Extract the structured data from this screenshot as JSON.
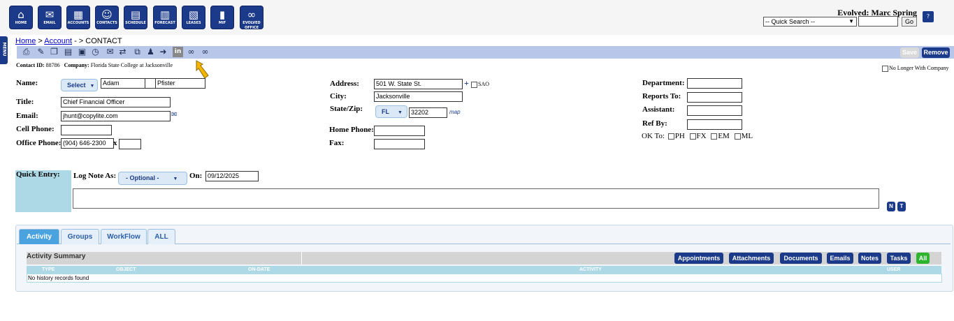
{
  "nav": {
    "items": [
      {
        "label": "HOME",
        "icon": "home-icon"
      },
      {
        "label": "EMAIL",
        "icon": "email-icon"
      },
      {
        "label": "ACCOUNTS",
        "icon": "accounts-icon"
      },
      {
        "label": "CONTACTS",
        "icon": "contacts-icon"
      },
      {
        "label": "SCHEDULE",
        "icon": "schedule-icon"
      },
      {
        "label": "FORECAST",
        "icon": "forecast-icon"
      },
      {
        "label": "LEASES",
        "icon": "leases-icon"
      },
      {
        "label": "MIF",
        "icon": "mif-icon"
      },
      {
        "label": "EVOLVED OFFICE",
        "icon": "evolved-office-icon"
      }
    ]
  },
  "user": {
    "greeting": "Evolved: Marc Spring"
  },
  "quick_search": {
    "selected": "-- Quick Search --",
    "value": "",
    "go_label": "Go"
  },
  "side_menu": {
    "label": "MENU"
  },
  "breadcrumb": {
    "home": "Home",
    "sep1": " > ",
    "account": "Account",
    "sep2": " - > CONTACT"
  },
  "actions": {
    "save": "Save",
    "remove": "Remove"
  },
  "meta": {
    "contact_id_label": "Contact ID:",
    "contact_id": "88786",
    "company_label": "Company:",
    "company": "Florida State College at Jacksonville",
    "no_longer": "No Longer With Company"
  },
  "form": {
    "name_label": "Name:",
    "name_select": "Select",
    "first": "Adam",
    "middle": "",
    "last": "Pfister",
    "title_label": "Title:",
    "title": "Chief Financial Officer",
    "email_label": "Email:",
    "email": "jhunt@copylite.com",
    "cell_label": "Cell Phone:",
    "cell": "",
    "office_label": "Office Phone:",
    "office": "(904) 646-2300",
    "ext_label": "x",
    "ext": "",
    "address_label": "Address:",
    "address": "501 W. State St.",
    "plus": "+",
    "sao": "SAO",
    "city_label": "City:",
    "city": "Jacksonville",
    "statezip_label": "State/Zip:",
    "state": "FL",
    "zip": "32202",
    "map": "map",
    "home_phone_label": "Home Phone:",
    "home_phone": "",
    "fax_label": "Fax:",
    "fax": "",
    "department_label": "Department:",
    "department": "",
    "reports_label": "Reports To:",
    "reports": "",
    "assistant_label": "Assistant:",
    "assistant": "",
    "refby_label": "Ref By:",
    "refby": "",
    "okto_label": "OK To:",
    "ok_ph": "PH",
    "ok_fx": "FX",
    "ok_em": "EM",
    "ok_ml": "ML"
  },
  "quick_entry": {
    "label": "Quick Entry:",
    "log_label": "Log Note As:",
    "log_select": "- Optional -",
    "on_label": "On:",
    "date": "09/12/2025",
    "note": "",
    "n_btn": "N",
    "t_btn": "T"
  },
  "tabs": [
    {
      "label": "Activity",
      "active": true
    },
    {
      "label": "Groups"
    },
    {
      "label": "WorkFlow"
    },
    {
      "label": "ALL"
    }
  ],
  "activity": {
    "summary_label": "Activity Summary",
    "filters": [
      "Appointments",
      "Attachments",
      "Documents",
      "Emails",
      "Notes",
      "Tasks",
      "All"
    ],
    "columns": [
      "TYPE",
      "OBJECT",
      "ON-DATE",
      "ACTIVITY",
      "USER"
    ],
    "empty": "No history records found"
  },
  "colors": {
    "nav": "#1c3a8a",
    "toolstrip": "#b8c6ea",
    "quick_entry": "#add8e6",
    "tab_active": "#4aa3df",
    "all_filter": "#2db52d"
  }
}
